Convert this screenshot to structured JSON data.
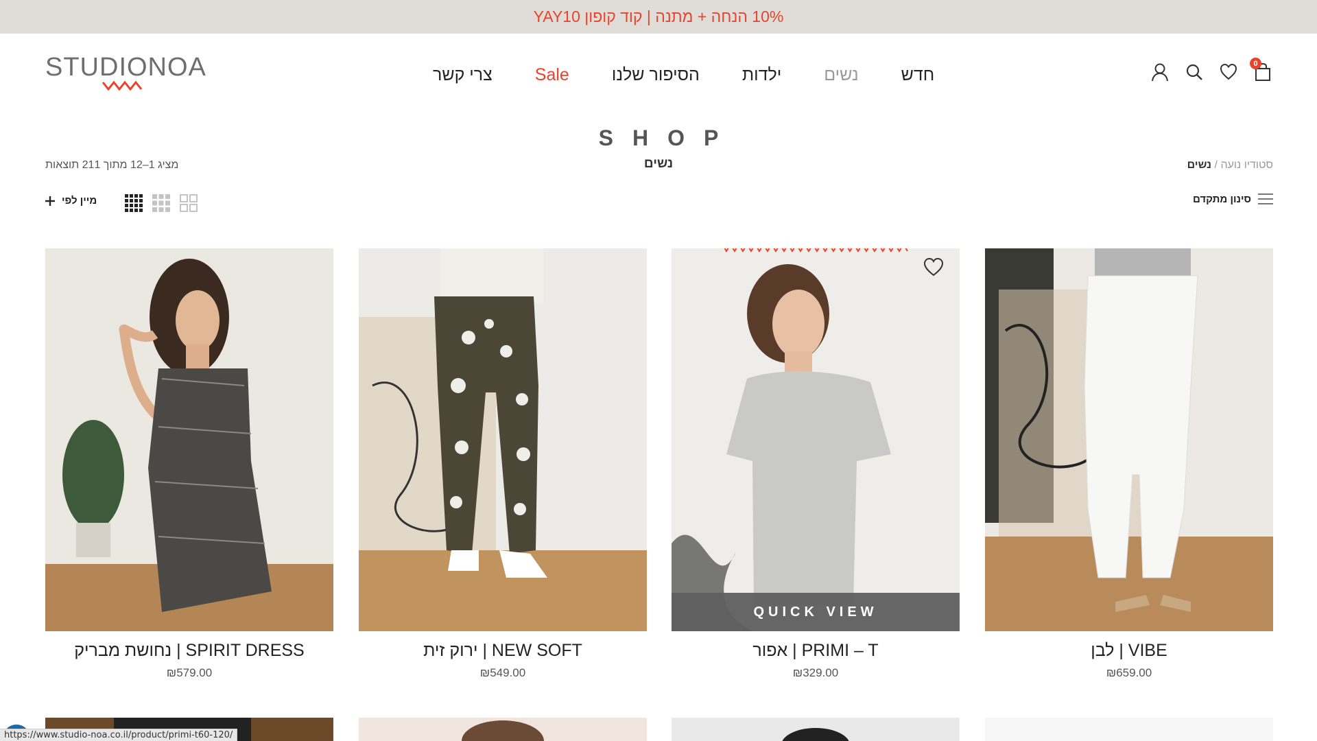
{
  "promo": {
    "text": "10% הנחה + מתנה | קוד קופון YAY10",
    "color": "#e8432d"
  },
  "header": {
    "logo": {
      "text": "STUDIONOA",
      "wave_color": "#e8432d"
    },
    "nav": [
      {
        "label": "חדש",
        "state": "normal"
      },
      {
        "label": "נשים",
        "state": "active"
      },
      {
        "label": "ילדות",
        "state": "normal"
      },
      {
        "label": "הסיפור שלנו",
        "state": "normal"
      },
      {
        "label": "Sale",
        "state": "sale"
      },
      {
        "label": "צרי קשר",
        "state": "normal"
      }
    ],
    "icons": [
      "user-icon",
      "search-icon",
      "heart-icon",
      "shopping-bag-icon"
    ],
    "cart_count": "0"
  },
  "page": {
    "title": "SHOP",
    "subtitle": "נשים",
    "breadcrumb": {
      "home": "סטודיו נועה",
      "separator": "/",
      "current": "נשים"
    },
    "result_count": "מציג 1–12 מתוך 211 תוצאות"
  },
  "toolbar": {
    "filter_label": "סינון מתקדם",
    "sort_label": "מיין לפי",
    "grid_options": [
      "grid-2-icon",
      "grid-3-icon",
      "grid-4-icon"
    ],
    "active_grid": "grid-4-icon"
  },
  "products": [
    {
      "name": "VIBE | לבן",
      "price": "₪659.00",
      "image": "white pants"
    },
    {
      "name": "PRIMI – T | אפור",
      "price": "₪329.00",
      "image": "grey t-shirt",
      "quick_view": "QUICK VIEW",
      "hovered": true
    },
    {
      "name": "NEW SOFT | ירוק זית",
      "price": "₪549.00",
      "image": "olive printed pants"
    },
    {
      "name": "SPIRIT DRESS | נחושת מבריק",
      "price": "₪579.00",
      "image": "metallic dress"
    }
  ],
  "status_bar": {
    "url": "https://www.studio-noa.co.il/product/primi-t60-120/"
  },
  "colors": {
    "accent": "#e8432d",
    "promo_bg": "#e0ddd9",
    "quick_view_bg": "#5f5f5f"
  }
}
